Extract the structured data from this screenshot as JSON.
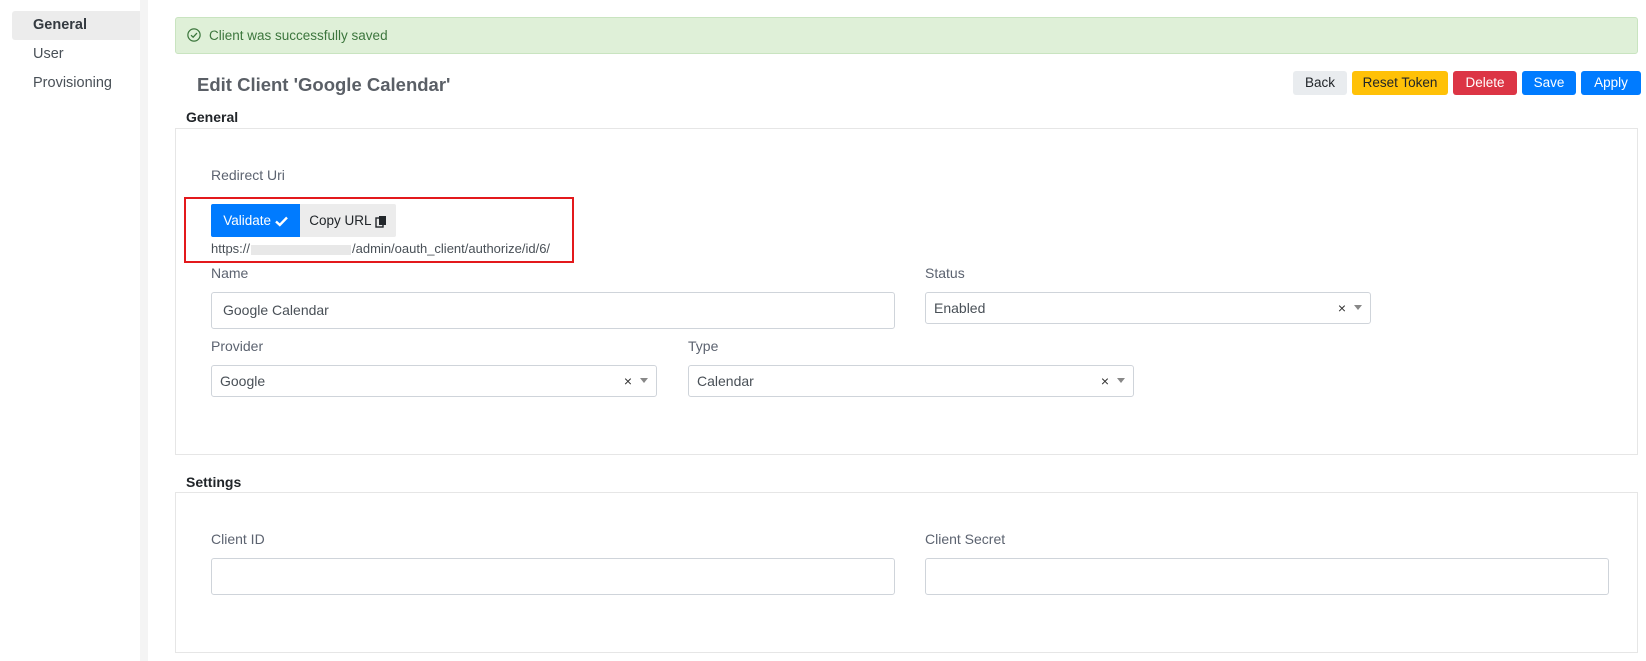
{
  "sidebar": {
    "items": [
      {
        "label": "General",
        "active": true
      },
      {
        "label": "User",
        "active": false
      },
      {
        "label": "Provisioning",
        "active": false
      }
    ]
  },
  "alert": {
    "message": "Client was successfully saved",
    "icon": "check-circle-icon",
    "color": "#3c763d"
  },
  "header": {
    "title": "Edit Client 'Google Calendar'"
  },
  "toolbar": {
    "back_label": "Back",
    "reset_label": "Reset Token",
    "delete_label": "Delete",
    "save_label": "Save",
    "apply_label": "Apply"
  },
  "general": {
    "section_title": "General",
    "redirect_uri_label": "Redirect Uri",
    "validate_label": "Validate",
    "copy_label": "Copy URL",
    "uri_prefix": "https://",
    "uri_suffix": "/admin/oauth_client/authorize/id/6/",
    "name_label": "Name",
    "name_value": "Google Calendar",
    "status_label": "Status",
    "status_value": "Enabled",
    "provider_label": "Provider",
    "provider_value": "Google",
    "type_label": "Type",
    "type_value": "Calendar"
  },
  "settings": {
    "section_title": "Settings",
    "client_id_label": "Client ID",
    "client_id_value": "",
    "client_secret_label": "Client Secret",
    "client_secret_value": ""
  },
  "colors": {
    "primary": "#007bff",
    "warning": "#ffc107",
    "danger": "#dc3545",
    "success_bg": "#dff0d8",
    "highlight": "#e3191c"
  }
}
